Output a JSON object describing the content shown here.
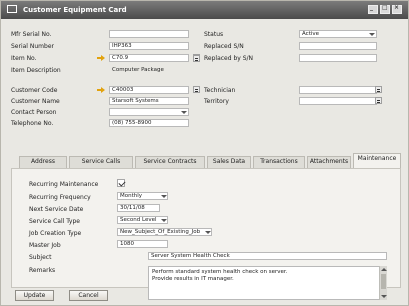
{
  "window": {
    "title": "Customer Equipment Card"
  },
  "form": {
    "mfr_serial": {
      "label": "Mfr Serial No.",
      "value": ""
    },
    "serial_number": {
      "label": "Serial Number",
      "value": "IHP363"
    },
    "item_no": {
      "label": "Item No.",
      "value": "C70.9"
    },
    "item_description": {
      "label": "Item Description",
      "value": "Computer Package"
    },
    "customer_code": {
      "label": "Customer Code",
      "value": "C40003"
    },
    "customer_name": {
      "label": "Customer Name",
      "value": "Starsoft Systems"
    },
    "contact_person": {
      "label": "Contact Person",
      "value": ""
    },
    "telephone_no": {
      "label": "Telephone No.",
      "value": "(08) 755-8900"
    },
    "status": {
      "label": "Status",
      "value": "Active"
    },
    "replaced_sn": {
      "label": "Replaced S/N",
      "value": ""
    },
    "replaced_by_sn": {
      "label": "Replaced by S/N",
      "value": ""
    },
    "technician": {
      "label": "Technician",
      "value": ""
    },
    "territory": {
      "label": "Territory",
      "value": ""
    }
  },
  "tabs": [
    {
      "label": "Address"
    },
    {
      "label": "Service Calls"
    },
    {
      "label": "Service Contracts"
    },
    {
      "label": "Sales Data"
    },
    {
      "label": "Transactions"
    },
    {
      "label": "Attachments"
    },
    {
      "label": "Maintenance"
    }
  ],
  "maintenance": {
    "recurring": {
      "label": "Recurring Maintenance",
      "checked": true
    },
    "frequency": {
      "label": "Recurring Frequency",
      "value": "Monthly"
    },
    "next_service_date": {
      "label": "Next Service Date",
      "value": "30/11/08"
    },
    "service_call_type": {
      "label": "Service Call Type",
      "value": "Second Level"
    },
    "job_creation_type": {
      "label": "Job Creation Type",
      "value": "New_Subject_Of_Existing_Job"
    },
    "master_job": {
      "label": "Master Job",
      "value": "1080"
    },
    "subject": {
      "label": "Subject",
      "value": "Server System Health Check"
    },
    "remarks": {
      "label": "Remarks",
      "lines": [
        "Perform standard system health check on server.",
        "Provide results in IT manager."
      ]
    }
  },
  "buttons": {
    "update": "Update",
    "cancel": "Cancel"
  }
}
